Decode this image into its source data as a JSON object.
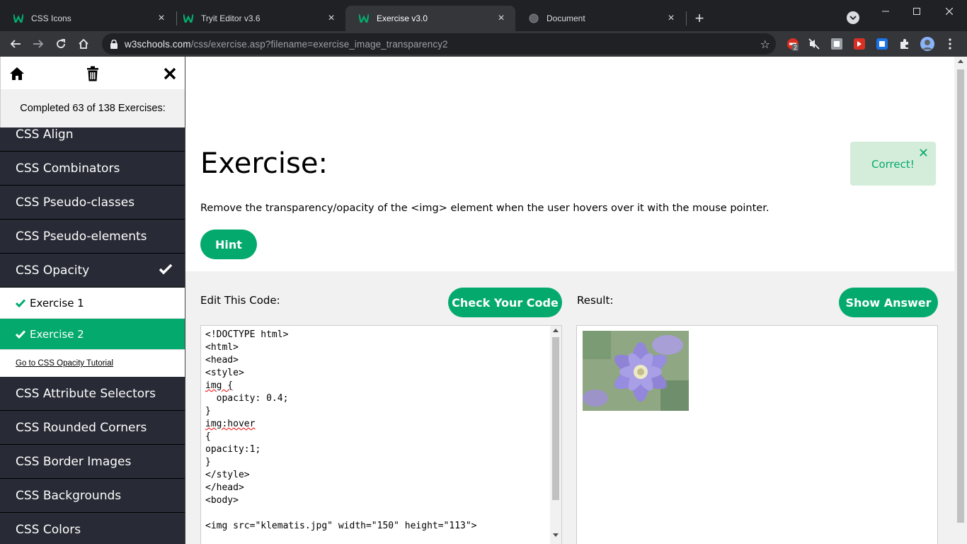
{
  "browser": {
    "tabs": [
      {
        "title": "CSS Icons",
        "active": false
      },
      {
        "title": "Tryit Editor v3.6",
        "active": false
      },
      {
        "title": "Exercise v3.0",
        "active": true
      },
      {
        "title": "Document",
        "active": false
      }
    ],
    "url_host": "w3schools.com",
    "url_path": "/css/exercise.asp?filename=exercise_image_transparency2",
    "extension_badge": "2"
  },
  "sidebar": {
    "progress_text": "Completed 63 of 138 Exercises:",
    "items_before": [
      "CSS Align",
      "CSS Combinators",
      "CSS Pseudo-classes",
      "CSS Pseudo-elements"
    ],
    "current_section": "CSS Opacity",
    "exercises": [
      {
        "label": "Exercise 1",
        "active": false
      },
      {
        "label": "Exercise 2",
        "active": true
      }
    ],
    "tutorial_link": "Go to CSS Opacity Tutorial",
    "items_after": [
      "CSS Attribute Selectors",
      "CSS Rounded Corners",
      "CSS Border Images",
      "CSS Backgrounds",
      "CSS Colors"
    ]
  },
  "exercise": {
    "title": "Exercise:",
    "description": "Remove the transparency/opacity of the <img> element when the user hovers over it with the mouse pointer.",
    "hint_label": "Hint",
    "alert_text": "Correct!",
    "alert_close": "✕"
  },
  "code": {
    "edit_label": "Edit This Code:",
    "check_label": "Check Your Code",
    "result_label": "Result:",
    "answer_label": "Show Answer",
    "lines": [
      "<!DOCTYPE html>",
      "<html>",
      "<head>",
      "<style>",
      "img {",
      "  opacity: 0.4;",
      "}",
      "img:hover",
      "{",
      "opacity:1;",
      "}",
      "</style>",
      "</head>",
      "<body>",
      "",
      "<img src=\"klematis.jpg\" width=\"150\" height=\"113\">"
    ]
  },
  "colors": {
    "accent": "#04aa6d",
    "sidebar_bg": "#282a35"
  }
}
